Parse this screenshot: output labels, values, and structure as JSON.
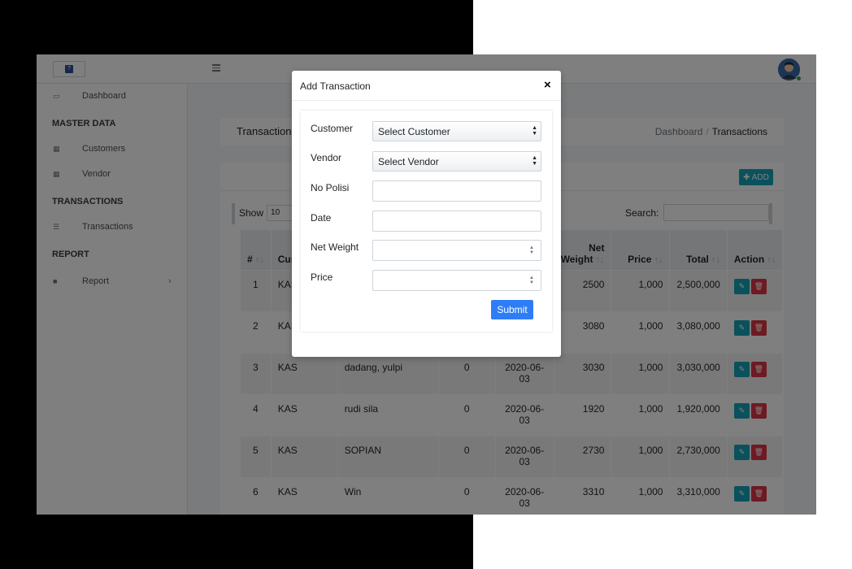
{
  "navbar": {
    "brand_icon": "app-logo",
    "menu_icon": "hamburger-icon",
    "avatar_icon": "user-avatar",
    "online_color": "#28a745"
  },
  "sidebar": {
    "items": [
      {
        "label": "Dashboard",
        "icon": "laptop-icon"
      },
      {
        "label": "Customers",
        "icon": "table-icon"
      },
      {
        "label": "Vendor",
        "icon": "table-icon"
      },
      {
        "label": "Transactions",
        "icon": "list-icon"
      },
      {
        "label": "Report",
        "icon": "file-icon",
        "chevron": "›"
      }
    ],
    "headers": [
      "MASTER DATA",
      "TRANSACTIONS",
      "REPORT"
    ]
  },
  "content": {
    "title": "Transactions",
    "breadcrumb": {
      "home": "Dashboard",
      "separator": "/",
      "current": "Transactions"
    }
  },
  "card": {
    "add_label": "✚ ADD",
    "show_label": "Show",
    "show_value": "10",
    "search_label": "Search:"
  },
  "table": {
    "columns": [
      "#",
      "Cus",
      "",
      "",
      "",
      "Net Weight",
      "Price",
      "Total",
      "Action"
    ],
    "rows": [
      {
        "no": "1",
        "cust": "KAS",
        "name": "",
        "zero": "",
        "date": "",
        "weight": "2500",
        "price": "1,000",
        "total": "2,500,000"
      },
      {
        "no": "2",
        "cust": "KAS",
        "name": "",
        "zero": "",
        "date": "",
        "weight": "3080",
        "price": "1,000",
        "total": "3,080,000"
      },
      {
        "no": "3",
        "cust": "KAS",
        "name": "dadang, yulpi",
        "zero": "0",
        "date": "2020-06-03",
        "weight": "3030",
        "price": "1,000",
        "total": "3,030,000"
      },
      {
        "no": "4",
        "cust": "KAS",
        "name": "rudi sila",
        "zero": "0",
        "date": "2020-06-03",
        "weight": "1920",
        "price": "1,000",
        "total": "1,920,000"
      },
      {
        "no": "5",
        "cust": "KAS",
        "name": "SOPIAN",
        "zero": "0",
        "date": "2020-06-03",
        "weight": "2730",
        "price": "1,000",
        "total": "2,730,000"
      },
      {
        "no": "6",
        "cust": "KAS",
        "name": "Win",
        "zero": "0",
        "date": "2020-06-03",
        "weight": "3310",
        "price": "1,000",
        "total": "3,310,000"
      }
    ],
    "edit_icon": "pencil-icon",
    "delete_icon": "trash-icon"
  },
  "modal": {
    "title": "Add Transaction",
    "close": "×",
    "fields": {
      "customer_label": "Customer",
      "customer_value": "Select Customer",
      "vendor_label": "Vendor",
      "vendor_value": "Select Vendor",
      "no_polisi_label": "No Polisi",
      "date_label": "Date",
      "net_weight_label": "Net Weight",
      "price_label": "Price"
    },
    "submit_label": "Submit",
    "submit_color": "#2f7df6"
  },
  "colors": {
    "accent": "#17a2b8",
    "danger": "#dc3545"
  }
}
